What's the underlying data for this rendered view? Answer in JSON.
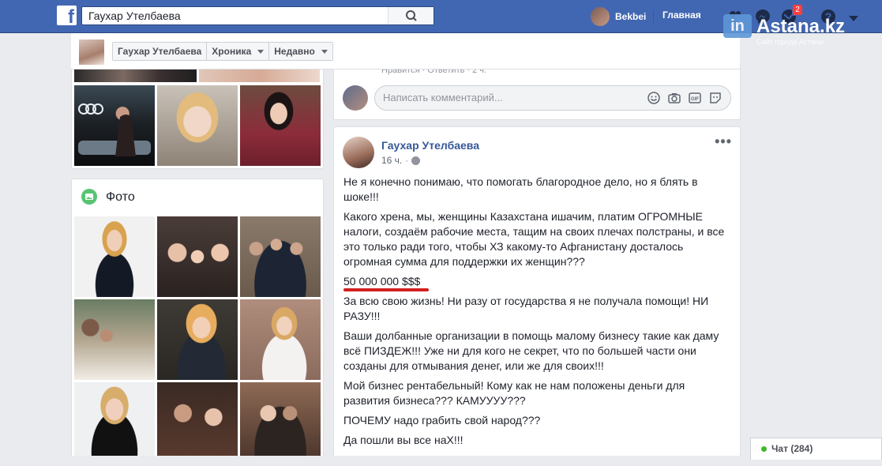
{
  "topbar": {
    "search_value": "Гаухар Утелбаева",
    "user_name": "Bekbei",
    "home_label": "Главная",
    "notifications_count": "2"
  },
  "watermark": {
    "logo": "in",
    "name": "Astana.kz",
    "tagline": "Сайт города Астаны"
  },
  "timeline_header": {
    "name": "Гаухар Утелбаева",
    "chronicle_label": "Хроника",
    "recent_label": "Недавно"
  },
  "photos_card": {
    "title": "Фото"
  },
  "comment_area": {
    "meta": "Нравится · Ответить · 2 ч.",
    "placeholder": "Написать комментарий..."
  },
  "post": {
    "author": "Гаухар Утелбаева",
    "time": "16 ч.",
    "more": "•••",
    "paragraphs": [
      "Не я конечно понимаю, что помогать благородное дело, но я блять в шоке!!!",
      "Какого хрена, мы, женщины Казахстана ишачим, платим ОГРОМНЫЕ налоги, создаём рабочие места, тащим на своих плечах полстраны, и все это только ради того, чтобы ХЗ какому-то Афганистану досталось огромная сумма для поддержки их женщин???",
      "50 000 000 $$$",
      "За всю свою жизнь! Ни разу от государства я не получала помощи! НИ РАЗУ!!!",
      "Ваши долбанные организации в помощь малому бизнесу такие как даму всё ПИЗДЕЖ!!! Уже ни для кого не секрет, что по большей части они созданы для отмывания денег, или же для своих!!!",
      "Мой бизнес рентабельный! Кому как не нам положены деньги для развития бизнеса??? КАМУУУУ???",
      "ПОЧЕМУ надо грабить свой народ???",
      "Да пошли вы все наХ!!!"
    ]
  },
  "chat": {
    "label": "Чат (284)"
  },
  "colors": {
    "facebook_blue": "#4267b2",
    "link_blue": "#365899",
    "highlight_underline": "#d21f1f",
    "online_green": "#42b72a"
  }
}
